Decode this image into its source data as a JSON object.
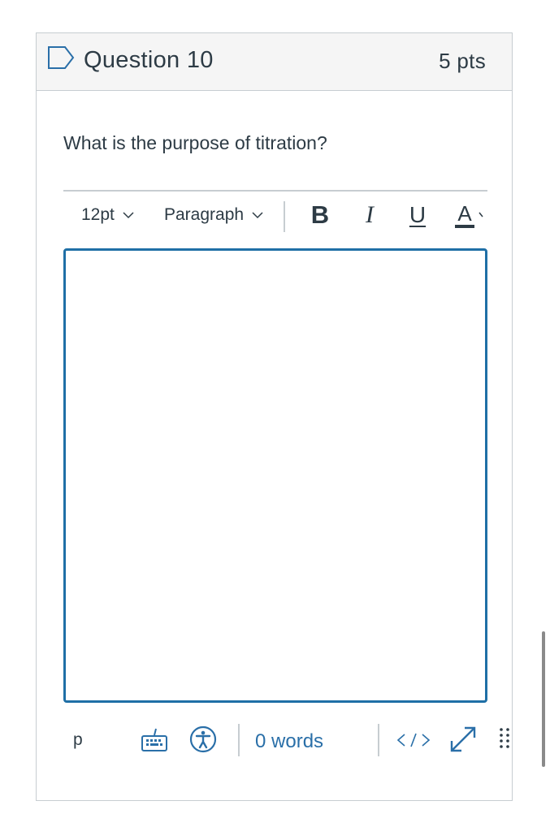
{
  "question": {
    "title": "Question 10",
    "points": "5 pts",
    "text": "What is the purpose of titration?",
    "flag_icon": "flag-outline-icon"
  },
  "toolbar": {
    "font_size": "12pt",
    "block_format": "Paragraph",
    "bold_label": "B",
    "italic_label": "I",
    "underline_label": "U",
    "text_color_label": "A",
    "icons": [
      "chevron-down-icon",
      "bold-icon",
      "italic-icon",
      "underline-icon",
      "text-color-icon"
    ]
  },
  "editor": {
    "content": ""
  },
  "status_bar": {
    "path": "p",
    "word_count": "0 words",
    "icons": [
      "keyboard-icon",
      "accessibility-icon",
      "html-code-icon",
      "fullscreen-icon",
      "drag-handle-icon"
    ]
  },
  "colors": {
    "accent": "#1f6fa6",
    "link": "#2a6fa8",
    "text": "#2d3b45",
    "border": "#c7cdd1",
    "header_bg": "#f5f5f5"
  }
}
